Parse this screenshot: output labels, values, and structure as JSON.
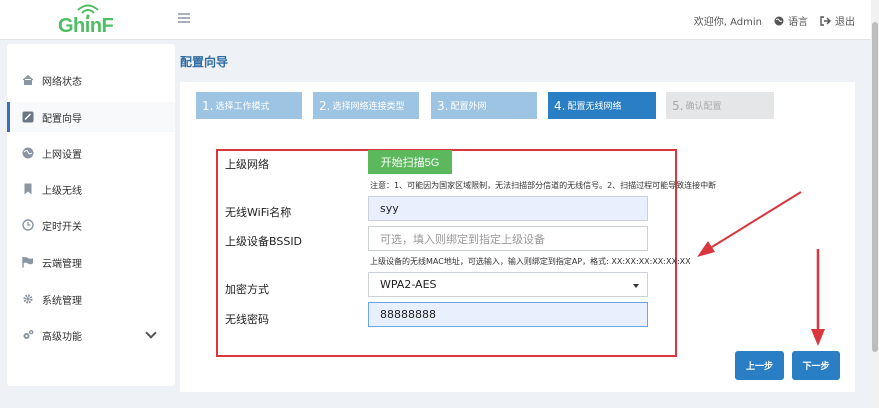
{
  "header": {
    "logo_text": "GhinF",
    "welcome": "欢迎你, Admin",
    "language": "语言",
    "logout": "退出"
  },
  "sidebar": {
    "items": [
      {
        "label": "网络状态",
        "icon": "home-icon"
      },
      {
        "label": "配置向导",
        "icon": "wizard-icon",
        "active": true
      },
      {
        "label": "上网设置",
        "icon": "globe-icon"
      },
      {
        "label": "上级无线",
        "icon": "bookmark-icon"
      },
      {
        "label": "定时开关",
        "icon": "clock-icon"
      },
      {
        "label": "云端管理",
        "icon": "flag-icon"
      },
      {
        "label": "系统管理",
        "icon": "gear-icon"
      },
      {
        "label": "高级功能",
        "icon": "gears-icon"
      }
    ]
  },
  "page": {
    "title": "配置向导"
  },
  "steps": [
    {
      "num": "1.",
      "label": "选择工作模式",
      "state": "done"
    },
    {
      "num": "2.",
      "label": "选择网络连接类型",
      "state": "done"
    },
    {
      "num": "3.",
      "label": "配置外网",
      "state": "done"
    },
    {
      "num": "4.",
      "label": "配置无线网络",
      "state": "current"
    },
    {
      "num": "5.",
      "label": "确认配置",
      "state": "todo"
    }
  ],
  "form": {
    "upstream_label": "上级网络",
    "scan_button": "开始扫描5G",
    "scan_note": "注意：1、可能因为国家区域限制，无法扫描部分信道的无线信号。2、扫描过程可能导致连接中断",
    "ssid_label": "无线WiFi名称",
    "ssid_value": "syy",
    "bssid_label": "上级设备BSSID",
    "bssid_placeholder": "可选，填入则绑定到指定上级设备",
    "bssid_note": "上级设备的无线MAC地址，可选输入，输入则绑定到指定AP，格式:  XX:XX:XX:XX:XX:XX",
    "encryption_label": "加密方式",
    "encryption_value": "WPA2-AES",
    "password_label": "无线密码",
    "password_value": "88888888"
  },
  "buttons": {
    "prev": "上一步",
    "next": "下一步"
  },
  "colors": {
    "brand_green": "#4ebd63",
    "primary": "#2a7fc4",
    "annotation_red": "#d9363e"
  }
}
